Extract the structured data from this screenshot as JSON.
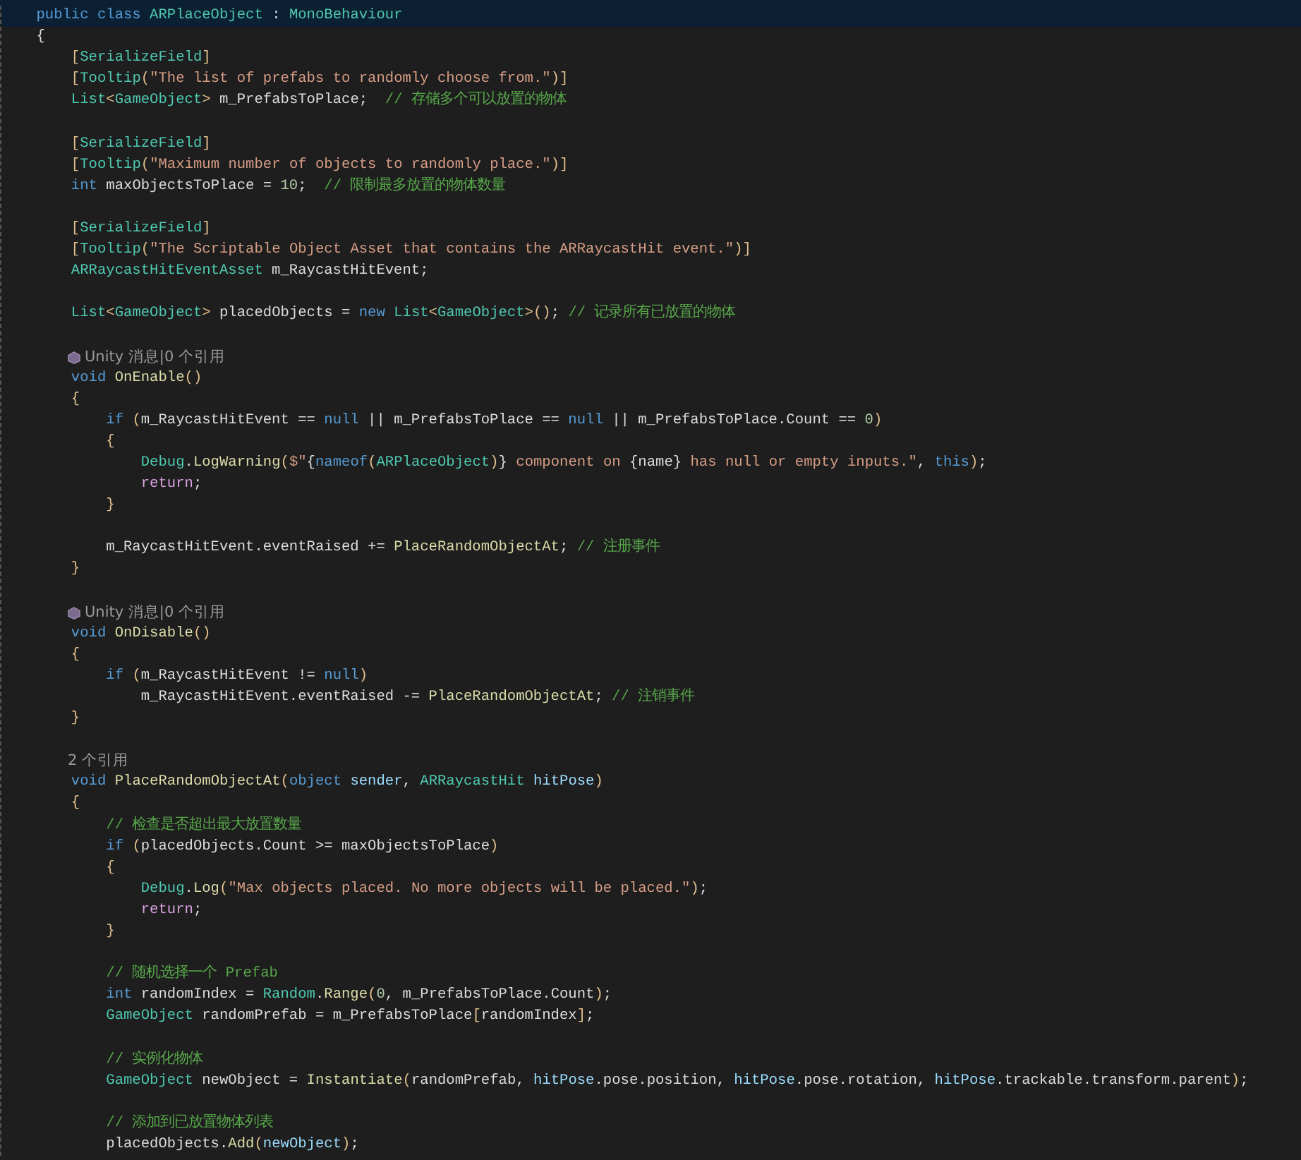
{
  "editor": {
    "lines": [
      {
        "kind": "sticky",
        "tokens": [
          {
            "kind": "kw",
            "text": "    public class "
          },
          {
            "kind": "type",
            "text": "ARPlaceObject"
          },
          {
            "kind": "plain",
            "text": " : "
          },
          {
            "kind": "type",
            "text": "MonoBehaviour"
          }
        ]
      },
      {
        "kind": "code",
        "tokens": [
          {
            "kind": "plain",
            "text": "    {"
          }
        ]
      },
      {
        "kind": "code",
        "tokens": [
          {
            "kind": "punc",
            "text": "        ["
          },
          {
            "kind": "type",
            "text": "SerializeField"
          },
          {
            "kind": "punc",
            "text": "]"
          }
        ]
      },
      {
        "kind": "code",
        "tokens": [
          {
            "kind": "punc",
            "text": "        ["
          },
          {
            "kind": "type",
            "text": "Tooltip"
          },
          {
            "kind": "punc",
            "text": "("
          },
          {
            "kind": "str",
            "text": "\"The list of prefabs to randomly choose from.\""
          },
          {
            "kind": "punc",
            "text": ")]"
          }
        ]
      },
      {
        "kind": "code",
        "tokens": [
          {
            "kind": "type",
            "text": "        List"
          },
          {
            "kind": "punc",
            "text": "<"
          },
          {
            "kind": "type",
            "text": "GameObject"
          },
          {
            "kind": "punc",
            "text": ">"
          },
          {
            "kind": "plain",
            "text": " m_PrefabsToPlace;  "
          },
          {
            "kind": "cmt",
            "text": "// 存储多个可以放置的物体"
          }
        ]
      },
      {
        "kind": "blank"
      },
      {
        "kind": "code",
        "tokens": [
          {
            "kind": "punc",
            "text": "        ["
          },
          {
            "kind": "type",
            "text": "SerializeField"
          },
          {
            "kind": "punc",
            "text": "]"
          }
        ]
      },
      {
        "kind": "code",
        "tokens": [
          {
            "kind": "punc",
            "text": "        ["
          },
          {
            "kind": "type",
            "text": "Tooltip"
          },
          {
            "kind": "punc",
            "text": "("
          },
          {
            "kind": "str",
            "text": "\"Maximum number of objects to randomly place.\""
          },
          {
            "kind": "punc",
            "text": ")]"
          }
        ]
      },
      {
        "kind": "code",
        "tokens": [
          {
            "kind": "kw",
            "text": "        int"
          },
          {
            "kind": "plain",
            "text": " maxObjectsToPlace = "
          },
          {
            "kind": "num",
            "text": "10"
          },
          {
            "kind": "plain",
            "text": ";  "
          },
          {
            "kind": "cmt",
            "text": "// 限制最多放置的物体数量"
          }
        ]
      },
      {
        "kind": "blank"
      },
      {
        "kind": "code",
        "tokens": [
          {
            "kind": "punc",
            "text": "        ["
          },
          {
            "kind": "type",
            "text": "SerializeField"
          },
          {
            "kind": "punc",
            "text": "]"
          }
        ]
      },
      {
        "kind": "code",
        "tokens": [
          {
            "kind": "punc",
            "text": "        ["
          },
          {
            "kind": "type",
            "text": "Tooltip"
          },
          {
            "kind": "punc",
            "text": "("
          },
          {
            "kind": "str",
            "text": "\"The Scriptable Object Asset that contains the ARRaycastHit event.\""
          },
          {
            "kind": "punc",
            "text": ")]"
          }
        ]
      },
      {
        "kind": "code",
        "tokens": [
          {
            "kind": "type",
            "text": "        ARRaycastHitEventAsset"
          },
          {
            "kind": "plain",
            "text": " m_RaycastHitEvent;"
          }
        ]
      },
      {
        "kind": "blank"
      },
      {
        "kind": "code",
        "tokens": [
          {
            "kind": "type",
            "text": "        List"
          },
          {
            "kind": "punc",
            "text": "<"
          },
          {
            "kind": "type",
            "text": "GameObject"
          },
          {
            "kind": "punc",
            "text": ">"
          },
          {
            "kind": "plain",
            "text": " placedObjects = "
          },
          {
            "kind": "kw",
            "text": "new "
          },
          {
            "kind": "type",
            "text": "List"
          },
          {
            "kind": "punc",
            "text": "<"
          },
          {
            "kind": "type",
            "text": "GameObject"
          },
          {
            "kind": "punc",
            "text": ">()"
          },
          {
            "kind": "plain",
            "text": "; "
          },
          {
            "kind": "cmt",
            "text": "// 记录所有已放置的物体"
          }
        ]
      },
      {
        "kind": "blank"
      },
      {
        "kind": "codelens",
        "unity_icon": true,
        "text": "Unity 消息|0 个引用"
      },
      {
        "kind": "code",
        "tokens": [
          {
            "kind": "kw",
            "text": "        void "
          },
          {
            "kind": "fn",
            "text": "OnEnable"
          },
          {
            "kind": "punc",
            "text": "()"
          }
        ]
      },
      {
        "kind": "code",
        "tokens": [
          {
            "kind": "punc",
            "text": "        {"
          }
        ]
      },
      {
        "kind": "code",
        "tokens": [
          {
            "kind": "kw",
            "text": "            if "
          },
          {
            "kind": "punc",
            "text": "("
          },
          {
            "kind": "plain",
            "text": "m_RaycastHitEvent == "
          },
          {
            "kind": "kw",
            "text": "null"
          },
          {
            "kind": "plain",
            "text": " || m_PrefabsToPlace == "
          },
          {
            "kind": "kw",
            "text": "null"
          },
          {
            "kind": "plain",
            "text": " || m_PrefabsToPlace.Count == "
          },
          {
            "kind": "num",
            "text": "0"
          },
          {
            "kind": "punc",
            "text": ")"
          }
        ]
      },
      {
        "kind": "code",
        "tokens": [
          {
            "kind": "punc",
            "text": "            {"
          }
        ]
      },
      {
        "kind": "code",
        "tokens": [
          {
            "kind": "type",
            "text": "                Debug"
          },
          {
            "kind": "plain",
            "text": "."
          },
          {
            "kind": "fn",
            "text": "LogWarning"
          },
          {
            "kind": "punc",
            "text": "("
          },
          {
            "kind": "str",
            "text": "$\""
          },
          {
            "kind": "plain",
            "text": "{"
          },
          {
            "kind": "kw",
            "text": "nameof"
          },
          {
            "kind": "punc",
            "text": "("
          },
          {
            "kind": "type",
            "text": "ARPlaceObject"
          },
          {
            "kind": "punc",
            "text": ")"
          },
          {
            "kind": "plain",
            "text": "}"
          },
          {
            "kind": "str",
            "text": " component on "
          },
          {
            "kind": "plain",
            "text": "{name}"
          },
          {
            "kind": "str",
            "text": " has null or empty inputs.\""
          },
          {
            "kind": "plain",
            "text": ", "
          },
          {
            "kind": "kw",
            "text": "this"
          },
          {
            "kind": "punc",
            "text": ")"
          },
          {
            "kind": "plain",
            "text": ";"
          }
        ]
      },
      {
        "kind": "code",
        "tokens": [
          {
            "kind": "ctl",
            "text": "                return"
          },
          {
            "kind": "plain",
            "text": ";"
          }
        ]
      },
      {
        "kind": "code",
        "tokens": [
          {
            "kind": "punc",
            "text": "            }"
          }
        ]
      },
      {
        "kind": "blank"
      },
      {
        "kind": "code",
        "tokens": [
          {
            "kind": "plain",
            "text": "            m_RaycastHitEvent.eventRaised += "
          },
          {
            "kind": "fn",
            "text": "PlaceRandomObjectAt"
          },
          {
            "kind": "plain",
            "text": "; "
          },
          {
            "kind": "cmt",
            "text": "// 注册事件"
          }
        ]
      },
      {
        "kind": "code",
        "tokens": [
          {
            "kind": "punc",
            "text": "        }"
          }
        ]
      },
      {
        "kind": "blank"
      },
      {
        "kind": "codelens",
        "unity_icon": true,
        "text": "Unity 消息|0 个引用"
      },
      {
        "kind": "code",
        "tokens": [
          {
            "kind": "kw",
            "text": "        void "
          },
          {
            "kind": "fn",
            "text": "OnDisable"
          },
          {
            "kind": "punc",
            "text": "()"
          }
        ]
      },
      {
        "kind": "code",
        "tokens": [
          {
            "kind": "punc",
            "text": "        {"
          }
        ]
      },
      {
        "kind": "code",
        "tokens": [
          {
            "kind": "kw",
            "text": "            if "
          },
          {
            "kind": "punc",
            "text": "("
          },
          {
            "kind": "plain",
            "text": "m_RaycastHitEvent != "
          },
          {
            "kind": "kw",
            "text": "null"
          },
          {
            "kind": "punc",
            "text": ")"
          }
        ]
      },
      {
        "kind": "code",
        "tokens": [
          {
            "kind": "plain",
            "text": "                m_RaycastHitEvent.eventRaised -= "
          },
          {
            "kind": "fn",
            "text": "PlaceRandomObjectAt"
          },
          {
            "kind": "plain",
            "text": "; "
          },
          {
            "kind": "cmt",
            "text": "// 注销事件"
          }
        ]
      },
      {
        "kind": "code",
        "tokens": [
          {
            "kind": "punc",
            "text": "        }"
          }
        ]
      },
      {
        "kind": "blank"
      },
      {
        "kind": "codelens",
        "unity_icon": false,
        "text": "2 个引用"
      },
      {
        "kind": "code",
        "tokens": [
          {
            "kind": "kw",
            "text": "        void "
          },
          {
            "kind": "fn",
            "text": "PlaceRandomObjectAt"
          },
          {
            "kind": "punc",
            "text": "("
          },
          {
            "kind": "kw",
            "text": "object "
          },
          {
            "kind": "param",
            "text": "sender"
          },
          {
            "kind": "plain",
            "text": ", "
          },
          {
            "kind": "type",
            "text": "ARRaycastHit "
          },
          {
            "kind": "param",
            "text": "hitPose"
          },
          {
            "kind": "punc",
            "text": ")"
          }
        ]
      },
      {
        "kind": "code",
        "tokens": [
          {
            "kind": "punc",
            "text": "        {"
          }
        ]
      },
      {
        "kind": "code",
        "tokens": [
          {
            "kind": "cmt",
            "text": "            // 检查是否超出最大放置数量"
          }
        ]
      },
      {
        "kind": "code",
        "tokens": [
          {
            "kind": "kw",
            "text": "            if "
          },
          {
            "kind": "punc",
            "text": "("
          },
          {
            "kind": "plain",
            "text": "placedObjects.Count >= maxObjectsToPlace"
          },
          {
            "kind": "punc",
            "text": ")"
          }
        ]
      },
      {
        "kind": "code",
        "tokens": [
          {
            "kind": "punc",
            "text": "            {"
          }
        ]
      },
      {
        "kind": "code",
        "tokens": [
          {
            "kind": "type",
            "text": "                Debug"
          },
          {
            "kind": "plain",
            "text": "."
          },
          {
            "kind": "fn",
            "text": "Log"
          },
          {
            "kind": "punc",
            "text": "("
          },
          {
            "kind": "str",
            "text": "\"Max objects placed. No more objects will be placed.\""
          },
          {
            "kind": "punc",
            "text": ")"
          },
          {
            "kind": "plain",
            "text": ";"
          }
        ]
      },
      {
        "kind": "code",
        "tokens": [
          {
            "kind": "ctl",
            "text": "                return"
          },
          {
            "kind": "plain",
            "text": ";"
          }
        ]
      },
      {
        "kind": "code",
        "tokens": [
          {
            "kind": "punc",
            "text": "            }"
          }
        ]
      },
      {
        "kind": "blank"
      },
      {
        "kind": "code",
        "tokens": [
          {
            "kind": "cmt",
            "text": "            // 随机选择一个 Prefab"
          }
        ]
      },
      {
        "kind": "code",
        "tokens": [
          {
            "kind": "kw",
            "text": "            int"
          },
          {
            "kind": "plain",
            "text": " randomIndex = "
          },
          {
            "kind": "type",
            "text": "Random"
          },
          {
            "kind": "plain",
            "text": "."
          },
          {
            "kind": "fn",
            "text": "Range"
          },
          {
            "kind": "punc",
            "text": "("
          },
          {
            "kind": "num",
            "text": "0"
          },
          {
            "kind": "plain",
            "text": ", m_PrefabsToPlace.Count"
          },
          {
            "kind": "punc",
            "text": ")"
          },
          {
            "kind": "plain",
            "text": ";"
          }
        ]
      },
      {
        "kind": "code",
        "tokens": [
          {
            "kind": "type",
            "text": "            GameObject"
          },
          {
            "kind": "plain",
            "text": " randomPrefab = m_PrefabsToPlace"
          },
          {
            "kind": "punc",
            "text": "["
          },
          {
            "kind": "plain",
            "text": "randomIndex"
          },
          {
            "kind": "punc",
            "text": "]"
          },
          {
            "kind": "plain",
            "text": ";"
          }
        ]
      },
      {
        "kind": "blank"
      },
      {
        "kind": "code",
        "tokens": [
          {
            "kind": "cmt",
            "text": "            // 实例化物体"
          }
        ]
      },
      {
        "kind": "code",
        "tokens": [
          {
            "kind": "type",
            "text": "            GameObject"
          },
          {
            "kind": "plain",
            "text": " newObject = "
          },
          {
            "kind": "fn",
            "text": "Instantiate"
          },
          {
            "kind": "punc",
            "text": "("
          },
          {
            "kind": "plain",
            "text": "randomPrefab, "
          },
          {
            "kind": "param",
            "text": "hitPose"
          },
          {
            "kind": "plain",
            "text": ".pose.position, "
          },
          {
            "kind": "param",
            "text": "hitPose"
          },
          {
            "kind": "plain",
            "text": ".pose.rotation, "
          },
          {
            "kind": "param",
            "text": "hitPose"
          },
          {
            "kind": "plain",
            "text": ".trackable.transform.parent"
          },
          {
            "kind": "punc",
            "text": ")"
          },
          {
            "kind": "plain",
            "text": ";"
          }
        ]
      },
      {
        "kind": "blank"
      },
      {
        "kind": "code",
        "tokens": [
          {
            "kind": "cmt",
            "text": "            // 添加到已放置物体列表"
          }
        ]
      },
      {
        "kind": "code",
        "tokens": [
          {
            "kind": "plain",
            "text": "            placedObjects."
          },
          {
            "kind": "fn",
            "text": "Add"
          },
          {
            "kind": "punc",
            "text": "("
          },
          {
            "kind": "param",
            "text": "newObject"
          },
          {
            "kind": "punc",
            "text": ")"
          },
          {
            "kind": "plain",
            "text": ";"
          }
        ]
      }
    ]
  }
}
